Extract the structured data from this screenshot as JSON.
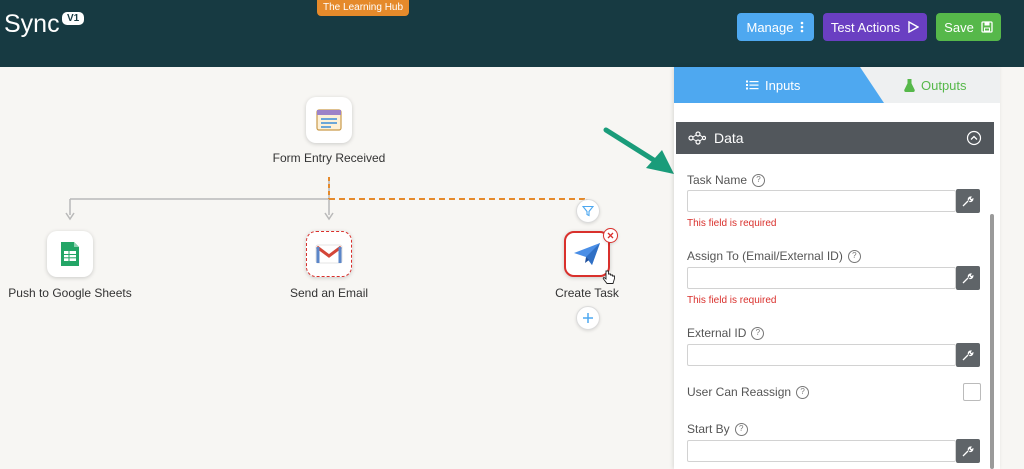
{
  "header": {
    "title": "Sync",
    "version": "V1",
    "hub_badge": "The Learning Hub",
    "buttons": {
      "manage": "Manage",
      "test_actions": "Test Actions",
      "save": "Save"
    },
    "colors": {
      "bar": "#173a42",
      "manage": "#4ea8f0",
      "test": "#6a3fc2",
      "save": "#56b84a",
      "hub": "#e58a2b"
    }
  },
  "workflow": {
    "trigger": {
      "label": "Form Entry Received",
      "icon": "form-icon"
    },
    "actions": [
      {
        "label": "Push to Google Sheets",
        "icon": "google-sheets-icon"
      },
      {
        "label": "Send an Email",
        "icon": "gmail-icon"
      },
      {
        "label": "Create Task",
        "icon": "paper-plane-icon"
      }
    ],
    "connector_colors": {
      "solid": "#b9b9b9",
      "dashed": "#e58a2b"
    }
  },
  "panel": {
    "tabs": {
      "inputs": "Inputs",
      "outputs": "Outputs"
    },
    "section_title": "Data",
    "fields": [
      {
        "label": "Task Name",
        "value": "",
        "error": "This field is required"
      },
      {
        "label": "Assign To (Email/External ID)",
        "value": "",
        "error": "This field is required"
      },
      {
        "label": "External ID",
        "value": ""
      },
      {
        "label": "User Can Reassign",
        "checked": false
      },
      {
        "label": "Start By",
        "value": ""
      }
    ],
    "help_glyph": "?"
  }
}
